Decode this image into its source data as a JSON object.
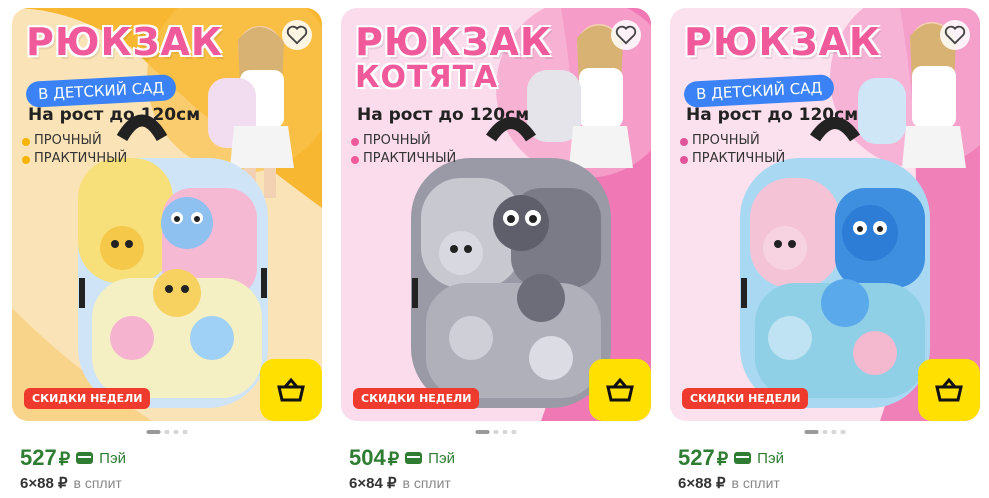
{
  "products": [
    {
      "title": "РЮКЗАК",
      "title2": "",
      "tag": "В ДЕТСКИЙ САД",
      "height": "На рост до 120см",
      "bullets": [
        "ПРОЧНЫЙ",
        "ПРАКТИЧНЫЙ"
      ],
      "promo": "СКИДКИ НЕДЕЛИ",
      "price": "527",
      "currency": "₽",
      "pay_label": "Пэй",
      "split_amount": "6×88 ₽",
      "split_label": "в сплит",
      "carousel_total": 4,
      "carousel_active": 0,
      "background_color": "#f7b731",
      "bullet_color": "#f5b400"
    },
    {
      "title": "РЮКЗАК",
      "title2": "КОТЯТА",
      "tag": "",
      "height": "На рост до 120см",
      "bullets": [
        "ПРОЧНЫЙ",
        "ПРАКТИЧНЫЙ"
      ],
      "promo": "СКИДКИ НЕДЕЛИ",
      "price": "504",
      "currency": "₽",
      "pay_label": "Пэй",
      "split_amount": "6×84 ₽",
      "split_label": "в сплит",
      "carousel_total": 4,
      "carousel_active": 0,
      "background_color": "#f078b5",
      "bullet_color": "#f05a9b"
    },
    {
      "title": "РЮКЗАК",
      "title2": "",
      "tag": "В ДЕТСКИЙ САД",
      "height": "На рост до 120см",
      "bullets": [
        "ПРОЧНЫЙ",
        "ПРАКТИЧНЫЙ"
      ],
      "promo": "СКИДКИ НЕДЕЛИ",
      "price": "527",
      "currency": "₽",
      "pay_label": "Пэй",
      "split_amount": "6×88 ₽",
      "split_label": "в сплит",
      "carousel_total": 4,
      "carousel_active": 0,
      "background_color": "#f080b8",
      "bullet_color": "#e0559a"
    }
  ],
  "icons": {
    "favorite": "heart-outline-icon",
    "cart": "basket-icon",
    "pay": "card-icon"
  },
  "colors": {
    "price_green": "#2e7d32",
    "cart_yellow": "#ffe000",
    "promo_red": "#ef3b2e"
  }
}
